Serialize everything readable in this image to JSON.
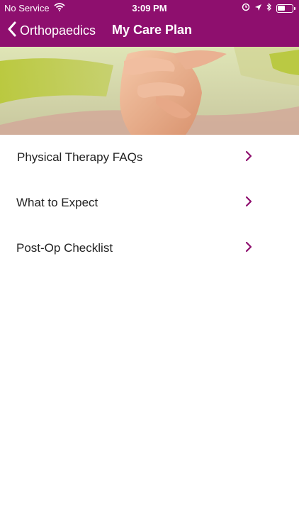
{
  "status_bar": {
    "carrier": "No Service",
    "time": "3:09 PM",
    "icons": [
      "wifi-icon",
      "location-icon",
      "alarm-icon",
      "bluetooth-icon",
      "battery-icon"
    ]
  },
  "nav": {
    "back_label": "Orthopaedics",
    "title": "My Care Plan"
  },
  "hero": {
    "image": "photo-knee-pain"
  },
  "menu": {
    "items": [
      {
        "label": "Physical Therapy FAQs",
        "icon": "chevron-right-icon"
      },
      {
        "label": "What to Expect",
        "icon": "chevron-right-icon"
      },
      {
        "label": "Post-Op Checklist",
        "icon": "chevron-right-icon"
      }
    ]
  },
  "colors": {
    "header": "#8e0f6e",
    "chevron": "#8e0f6e",
    "text": "#222222",
    "background": "#ffffff"
  }
}
